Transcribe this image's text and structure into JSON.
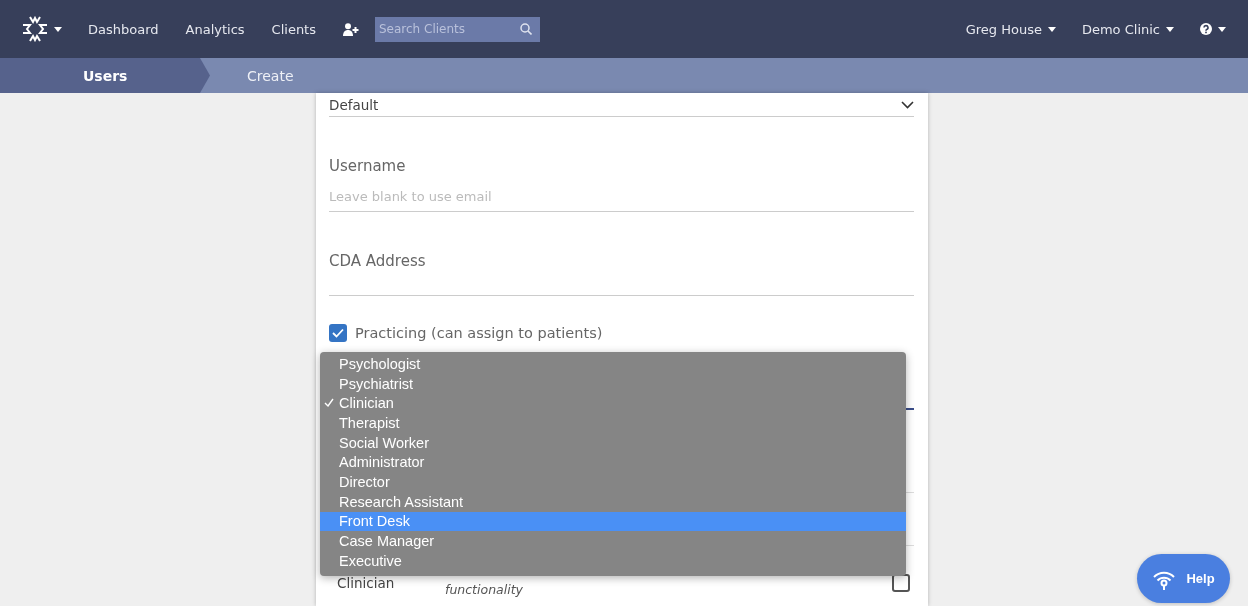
{
  "nav": {
    "menu_items": [
      "Dashboard",
      "Analytics",
      "Clients"
    ],
    "search": {
      "placeholder": "Search Clients"
    },
    "user": "Greg House",
    "clinic": "Demo Clinic"
  },
  "breadcrumb": [
    {
      "label": "Users"
    },
    {
      "label": "Create"
    }
  ],
  "form": {
    "select_value": "Default",
    "username": {
      "label": "Username",
      "placeholder": "Leave blank to use email"
    },
    "cda": {
      "label": "CDA Address"
    },
    "practicing": {
      "label": "Practicing (can assign to patients)",
      "checked": true
    },
    "role_row": {
      "name": "Clinician",
      "description": "functionality",
      "checked": false
    }
  },
  "dropdown": {
    "options": [
      {
        "label": "Psychologist",
        "checked": false,
        "selected": false
      },
      {
        "label": "Psychiatrist",
        "checked": false,
        "selected": false
      },
      {
        "label": "Clinician",
        "checked": true,
        "selected": false
      },
      {
        "label": "Therapist",
        "checked": false,
        "selected": false
      },
      {
        "label": "Social Worker",
        "checked": false,
        "selected": false
      },
      {
        "label": "Administrator",
        "checked": false,
        "selected": false
      },
      {
        "label": "Director",
        "checked": false,
        "selected": false
      },
      {
        "label": "Research Assistant",
        "checked": false,
        "selected": false
      },
      {
        "label": "Front Desk",
        "checked": false,
        "selected": true
      },
      {
        "label": "Case Manager",
        "checked": false,
        "selected": false
      },
      {
        "label": "Executive",
        "checked": false,
        "selected": false
      }
    ]
  },
  "help_button": {
    "label": "Help"
  }
}
